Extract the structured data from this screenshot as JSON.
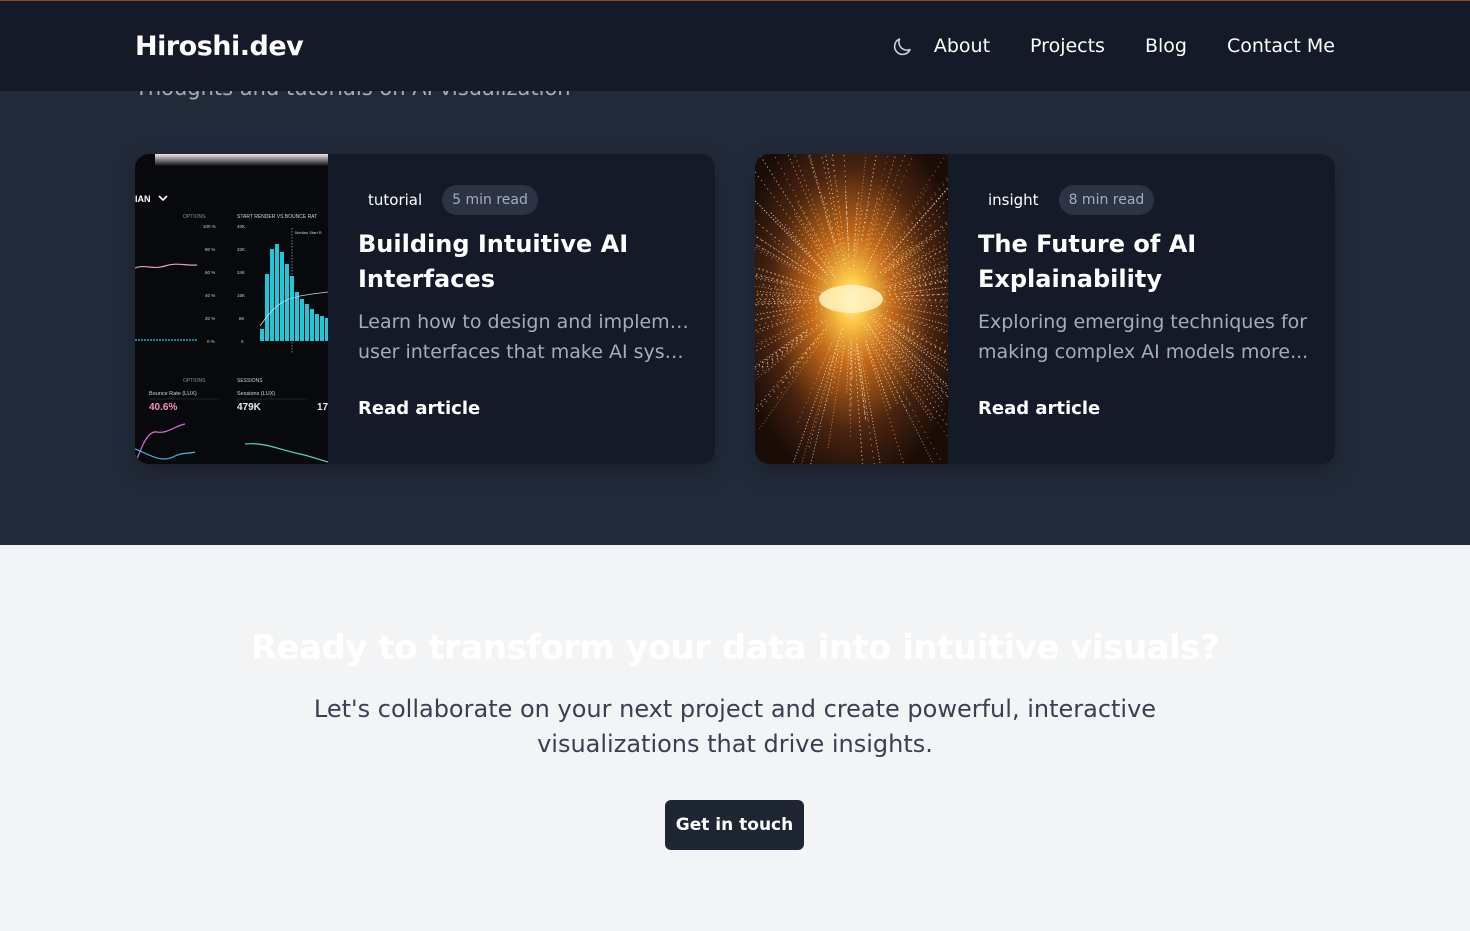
{
  "header": {
    "brand": "Hiroshi.dev",
    "theme_toggle_icon": "moon-icon",
    "nav": [
      {
        "label": "About"
      },
      {
        "label": "Projects"
      },
      {
        "label": "Blog"
      },
      {
        "label": "Contact Me"
      }
    ]
  },
  "blog": {
    "subtitle": "Thoughts and tutorials on AI visualization",
    "posts": [
      {
        "image": "analytics-dashboard-image",
        "category": "tutorial",
        "read_time": "5 min read",
        "title_line1": "Building Intuitive AI",
        "title_line2": "Interfaces",
        "excerpt_line1": "Learn how to design and implement",
        "excerpt_line2": "user interfaces that make AI system...",
        "link": "Read article",
        "image_labels": {
          "menu": "IAN",
          "options_top": "OPTIONS",
          "chart_title": "START RENDER VS BOUNCE RAT",
          "median": "Median Start R",
          "options_bottom": "OPTIONS",
          "sessions": "SESSIONS",
          "bounce_label": "Bounce Rate (LUX)",
          "bounce_value": "40.6%",
          "sessions_label": "Sessions (LUX)",
          "sessions_value": "479K",
          "extra_value": "17",
          "pct_axis": [
            "100 %",
            "80 %",
            "60 %",
            "40 %",
            "20 %",
            "0 %"
          ],
          "k_axis": [
            "40K",
            "32K",
            "24K",
            "16K",
            "8K",
            "0"
          ]
        }
      },
      {
        "image": "light-tunnel-image",
        "category": "insight",
        "read_time": "8 min read",
        "title_line1": "The Future of AI",
        "title_line2": "Explainability",
        "excerpt_line1": "Exploring emerging techniques for",
        "excerpt_line2": "making complex AI models more...",
        "link": "Read article"
      }
    ]
  },
  "cta": {
    "title": "Ready to transform your data into intuitive visuals?",
    "text_line1": "Let's collaborate on your next project and create powerful, interactive",
    "text_line2": "visualizations that drive insights.",
    "button": "Get in touch"
  },
  "colors": {
    "header_bg": "#141a27",
    "section_bg": "#222a3a",
    "card_bg": "#141a27",
    "cta_bg": "#f3f4f6",
    "button_bg": "#1f2633",
    "chart_accent": "#1ec8d8"
  }
}
